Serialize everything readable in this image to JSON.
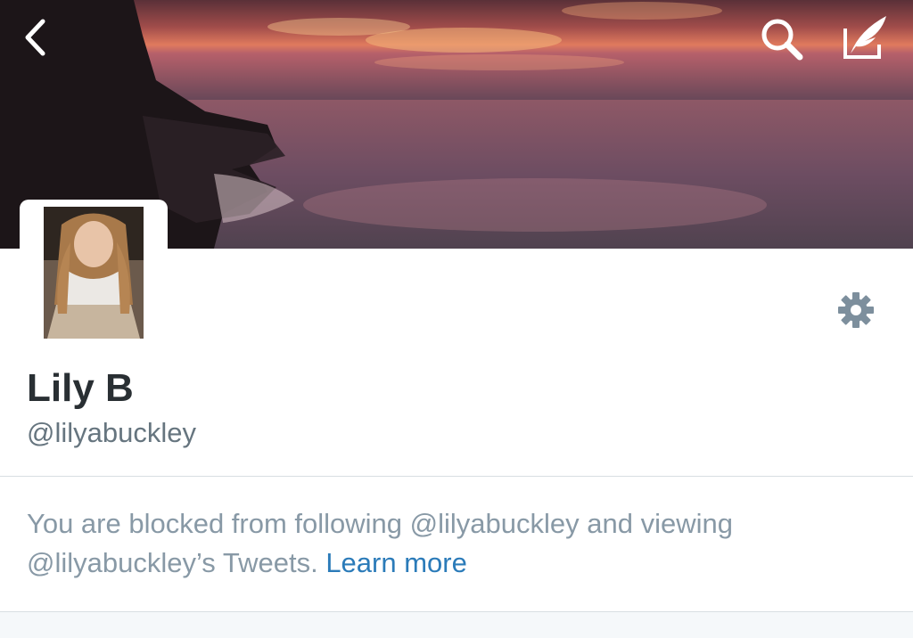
{
  "nav": {
    "back_icon": "chevron-left-icon",
    "search_icon": "search-icon",
    "compose_icon": "compose-tweet-icon"
  },
  "header": {
    "banner_description_colors": [
      "#6e3a3c",
      "#d2705d",
      "#7a4e5e"
    ]
  },
  "profile": {
    "name": "Lily B",
    "handle": "@lilyabuckley",
    "settings_icon": "gear-icon"
  },
  "blocked": {
    "message": "You are blocked from following @lilyabuckley and viewing @lilyabuckley’s Tweets.",
    "link_label": "Learn more"
  },
  "colors": {
    "name": "#292f33",
    "handle": "#66757f",
    "message": "#8899a6",
    "link": "#2b7bb9",
    "icon_gray": "#7d8f9d"
  }
}
